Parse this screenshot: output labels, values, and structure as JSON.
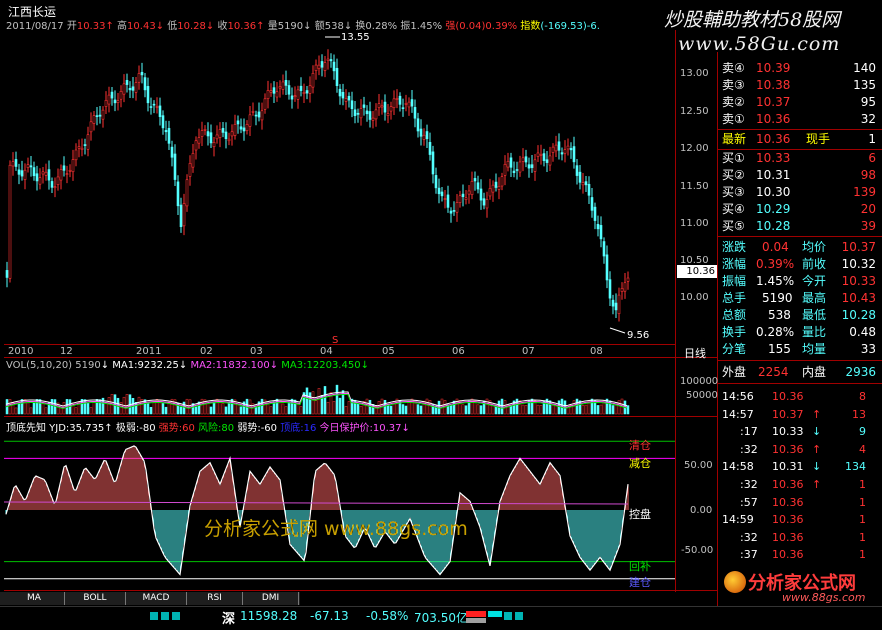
{
  "stock": {
    "name": "江西长运",
    "date": "2011/08/17",
    "open_label": "开",
    "open": "10.33",
    "high_label": "高",
    "high": "10.43",
    "low_label": "低",
    "low": "10.28",
    "close_label": "收",
    "close": "10.36",
    "vol_label": "量",
    "vol": "5190",
    "amount_label": "额",
    "amount": "538",
    "turnover_label": "换",
    "turnover": "0.28%",
    "amp_label": "振",
    "amp": "1.45%",
    "strength_label": "强",
    "strength": "(0.04)0.39%",
    "index_label": "指数",
    "index": "(-169.53)-6."
  },
  "watermark": {
    "top_title": "炒股輔助教材58股网",
    "top_url": "www.58Gu.com",
    "mid_text": "分析家公式网 www.88gs.com",
    "logo_text": "分析家公式网",
    "logo_url": "www.88gs.com"
  },
  "price_axis": {
    "ticks": [
      "13.00",
      "12.50",
      "12.00",
      "11.50",
      "11.00",
      "10.50",
      "10.00"
    ],
    "current": "10.36",
    "max_label": "13.55",
    "min_label": "9.56",
    "signal_mark": "S"
  },
  "time_axis": {
    "labels": [
      "2010",
      "12",
      "2011",
      "02",
      "03",
      "04",
      "05",
      "06",
      "07",
      "08"
    ],
    "period": "日线"
  },
  "volume": {
    "title": "VOL(5,10,20) 5190",
    "ma1": "MA1:9232.25",
    "ma2": "MA2:11832.100",
    "ma3": "MA3:12203.450",
    "axis": [
      "100000",
      "50000"
    ]
  },
  "indicator": {
    "title": "顶底先知 YJD:35.735",
    "jiruo": "极弱:-80",
    "qiangshi": "强势:60",
    "fengxian": "风险:80",
    "ruoshi": "弱势:-60",
    "hidden": "顶底:16",
    "protect": "今日保护价:10.37",
    "axis": [
      "50.00",
      "0.00",
      "-50.00"
    ],
    "zone_labels": {
      "qingcang": "清仓",
      "jiancang": "减仓",
      "kongpan": "控盘",
      "huibu": "回补",
      "jianchang": "建仓"
    }
  },
  "tabs": [
    "MA",
    "BOLL",
    "MACD",
    "RSI",
    "DMI"
  ],
  "orderbook": {
    "asks": [
      {
        "label": "卖④",
        "price": "10.39",
        "vol": "140"
      },
      {
        "label": "卖③",
        "price": "10.38",
        "vol": "135"
      },
      {
        "label": "卖②",
        "price": "10.37",
        "vol": "95"
      },
      {
        "label": "卖①",
        "price": "10.36",
        "vol": "32"
      }
    ],
    "last": {
      "label": "最新",
      "price": "10.36",
      "hand_label": "现手",
      "hand": "1"
    },
    "bids": [
      {
        "label": "买①",
        "price": "10.33",
        "vol": "6"
      },
      {
        "label": "买②",
        "price": "10.31",
        "vol": "98"
      },
      {
        "label": "买③",
        "price": "10.30",
        "vol": "139"
      },
      {
        "label": "买④",
        "price": "10.29",
        "vol": "20"
      },
      {
        "label": "买⑤",
        "price": "10.28",
        "vol": "39"
      }
    ]
  },
  "stats": [
    {
      "l1": "涨跌",
      "v1": "0.04",
      "l2": "均价",
      "v2": "10.37"
    },
    {
      "l1": "涨幅",
      "v1": "0.39%",
      "l2": "前收",
      "v2": "10.32"
    },
    {
      "l1": "振幅",
      "v1": "1.45%",
      "l2": "今开",
      "v2": "10.33"
    },
    {
      "l1": "总手",
      "v1": "5190",
      "l2": "最高",
      "v2": "10.43"
    },
    {
      "l1": "总额",
      "v1": "538",
      "l2": "最低",
      "v2": "10.28"
    },
    {
      "l1": "换手",
      "v1": "0.28%",
      "l2": "量比",
      "v2": "0.48"
    },
    {
      "l1": "分笔",
      "v1": "155",
      "l2": "均量",
      "v2": "33"
    }
  ],
  "outer_inner": {
    "outer_label": "外盘",
    "outer": "2254",
    "inner_label": "内盘",
    "inner": "2936"
  },
  "ticks": [
    {
      "time": "14:56",
      "price": "10.36",
      "arrow": "",
      "vol": "8"
    },
    {
      "time": "14:57",
      "price": "10.37",
      "arrow": "↑",
      "vol": "13"
    },
    {
      "time": ":17",
      "price": "10.33",
      "arrow": "↓",
      "vol": "9"
    },
    {
      "time": ":32",
      "price": "10.36",
      "arrow": "↑",
      "vol": "4"
    },
    {
      "time": "14:58",
      "price": "10.31",
      "arrow": "↓",
      "vol": "134"
    },
    {
      "time": ":32",
      "price": "10.36",
      "arrow": "↑",
      "vol": "1"
    },
    {
      "time": ":57",
      "price": "10.36",
      "arrow": "",
      "vol": "1"
    },
    {
      "time": "14:59",
      "price": "10.36",
      "arrow": "",
      "vol": "1"
    },
    {
      "time": ":32",
      "price": "10.36",
      "arrow": "",
      "vol": "1"
    },
    {
      "time": ":37",
      "price": "10.36",
      "arrow": "",
      "vol": "1"
    }
  ],
  "statusbar": {
    "market": "深",
    "index": "11598.28",
    "change": "-67.13",
    "pct": "-0.58%",
    "amount": "703.50亿"
  }
}
